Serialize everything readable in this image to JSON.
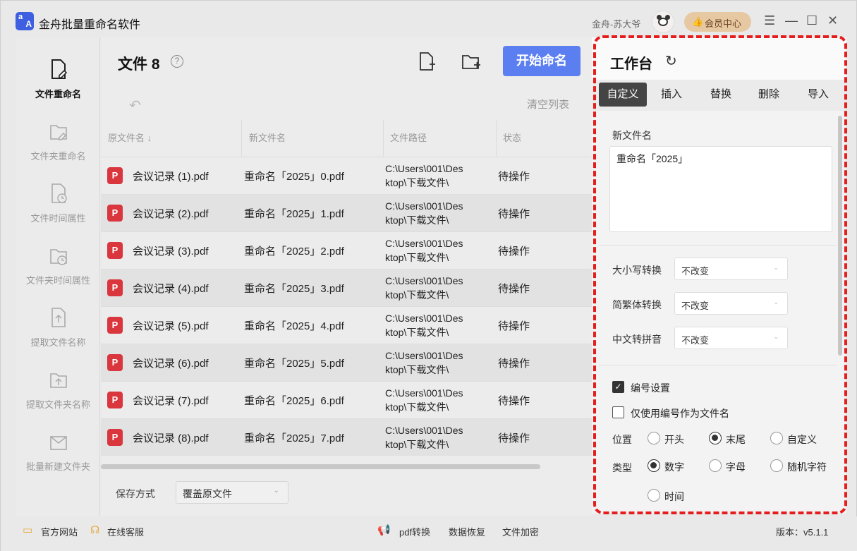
{
  "app": {
    "title": "金舟批量重命名软件",
    "user_name": "金舟-苏大爷",
    "vip_label": "会员中心",
    "logo_top": "a",
    "logo_bottom": "A",
    "controls": {
      "menu": "☰",
      "minimize": "—",
      "maximize": "☐",
      "close": "✕"
    }
  },
  "nav": {
    "items": [
      {
        "label": "文件重命名",
        "icon": "file-edit-icon",
        "active": true
      },
      {
        "label": "文件夹重命名",
        "icon": "folder-edit-icon",
        "active": false
      },
      {
        "label": "文件时间属性",
        "icon": "file-clock-icon",
        "active": false
      },
      {
        "label": "文件夹时间属性",
        "icon": "folder-clock-icon",
        "active": false
      },
      {
        "label": "提取文件名称",
        "icon": "file-upload-icon",
        "active": false
      },
      {
        "label": "提取文件夹名称",
        "icon": "folder-upload-icon",
        "active": false
      },
      {
        "label": "批量新建文件夹",
        "icon": "folder-new-icon",
        "active": false
      }
    ]
  },
  "main": {
    "title": "文件 8",
    "help": "?",
    "start_label": "开始命名",
    "clear_label": "清空列表",
    "undo": "↶",
    "columns": [
      "原文件名 ↓",
      "新文件名",
      "文件路径",
      "状态"
    ],
    "rows": [
      {
        "orig": "会议记录 (1).pdf",
        "new": "重命名「2025」0.pdf",
        "path1": "C:\\Users\\001\\Des",
        "path2": "ktop\\下载文件\\",
        "status": "待操作"
      },
      {
        "orig": "会议记录 (2).pdf",
        "new": "重命名「2025」1.pdf",
        "path1": "C:\\Users\\001\\Des",
        "path2": "ktop\\下载文件\\",
        "status": "待操作"
      },
      {
        "orig": "会议记录 (3).pdf",
        "new": "重命名「2025」2.pdf",
        "path1": "C:\\Users\\001\\Des",
        "path2": "ktop\\下载文件\\",
        "status": "待操作"
      },
      {
        "orig": "会议记录 (4).pdf",
        "new": "重命名「2025」3.pdf",
        "path1": "C:\\Users\\001\\Des",
        "path2": "ktop\\下载文件\\",
        "status": "待操作"
      },
      {
        "orig": "会议记录 (5).pdf",
        "new": "重命名「2025」4.pdf",
        "path1": "C:\\Users\\001\\Des",
        "path2": "ktop\\下载文件\\",
        "status": "待操作"
      },
      {
        "orig": "会议记录 (6).pdf",
        "new": "重命名「2025」5.pdf",
        "path1": "C:\\Users\\001\\Des",
        "path2": "ktop\\下载文件\\",
        "status": "待操作"
      },
      {
        "orig": "会议记录 (7).pdf",
        "new": "重命名「2025」6.pdf",
        "path1": "C:\\Users\\001\\Des",
        "path2": "ktop\\下载文件\\",
        "status": "待操作"
      },
      {
        "orig": "会议记录 (8).pdf",
        "new": "重命名「2025」7.pdf",
        "path1": "C:\\Users\\001\\Des",
        "path2": "ktop\\下载文件\\",
        "status": "待操作"
      }
    ],
    "save_label": "保存方式",
    "save_value": "覆盖原文件"
  },
  "panel": {
    "title": "工作台",
    "refresh": "↻",
    "tabs": [
      "自定义",
      "插入",
      "替换",
      "删除",
      "导入"
    ],
    "new_name_label": "新文件名",
    "new_name_value": "重命名「2025」",
    "case_label": "大小写转换",
    "case_value": "不改变",
    "trad_label": "简繁体转换",
    "trad_value": "不改变",
    "pinyin_label": "中文转拼音",
    "pinyin_value": "不改变",
    "numbering_label": "编号设置",
    "numbering_checked": true,
    "only_number_label": "仅使用编号作为文件名",
    "only_number_checked": false,
    "position_label": "位置",
    "position_options": [
      "开头",
      "末尾",
      "自定义"
    ],
    "position_selected": "末尾",
    "type_label": "类型",
    "type_options": [
      "数字",
      "字母",
      "随机字符",
      "时间"
    ],
    "type_selected": "数字",
    "check_mark": "✓",
    "caret": "⌄"
  },
  "status": {
    "website": "官方网站",
    "service": "在线客服",
    "pdf": "pdf转换",
    "recovery": "数据恢复",
    "encrypt": "文件加密",
    "version": "版本：v5.1.1"
  },
  "colors": {
    "accent": "#5b7ff0",
    "highlight_border": "#e51d1d",
    "pdf_red": "#d9363e",
    "vip": "#e6c8a3"
  }
}
